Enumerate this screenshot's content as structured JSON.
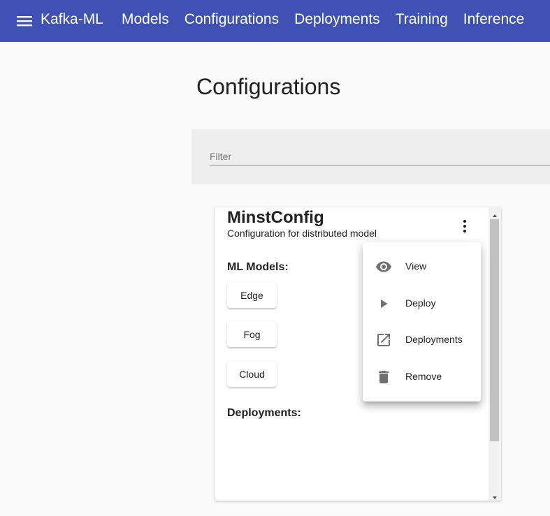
{
  "toolbar": {
    "brand": "Kafka-ML",
    "nav": [
      "Models",
      "Configurations",
      "Deployments",
      "Training",
      "Inference"
    ],
    "menu_icon": "menu-icon",
    "color": "#3f51b5"
  },
  "page": {
    "title": "Configurations"
  },
  "filter": {
    "placeholder": "Filter",
    "value": ""
  },
  "card": {
    "title": "MinstConfig",
    "subtitle": "Configuration for distributed model",
    "models_label": "ML Models:",
    "models": [
      "Edge",
      "Fog",
      "Cloud"
    ],
    "deployments_label": "Deployments:",
    "more_icon": "more-vert-icon"
  },
  "menu": {
    "items": [
      {
        "label": "View",
        "icon": "eye-icon"
      },
      {
        "label": "Deploy",
        "icon": "play-icon"
      },
      {
        "label": "Deployments",
        "icon": "open-in-new-icon"
      },
      {
        "label": "Remove",
        "icon": "trash-icon"
      }
    ]
  }
}
